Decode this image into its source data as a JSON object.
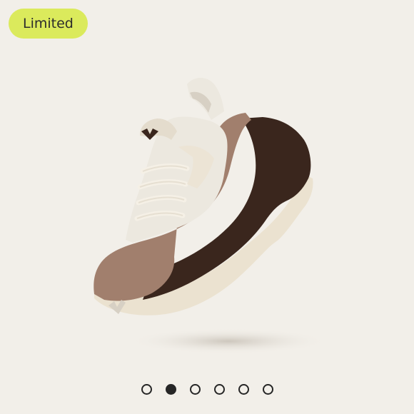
{
  "badge": {
    "label": "Limited",
    "color": "#dbea5c"
  },
  "product": {
    "colors": {
      "background": "#f2efe9",
      "knit": "#ece8df",
      "sole_dark": "#3a261d",
      "overlay_taupe": "#a17f6d",
      "outsole_cream": "#ebe2d0"
    }
  },
  "carousel": {
    "slides": 6,
    "active_index": 1
  }
}
